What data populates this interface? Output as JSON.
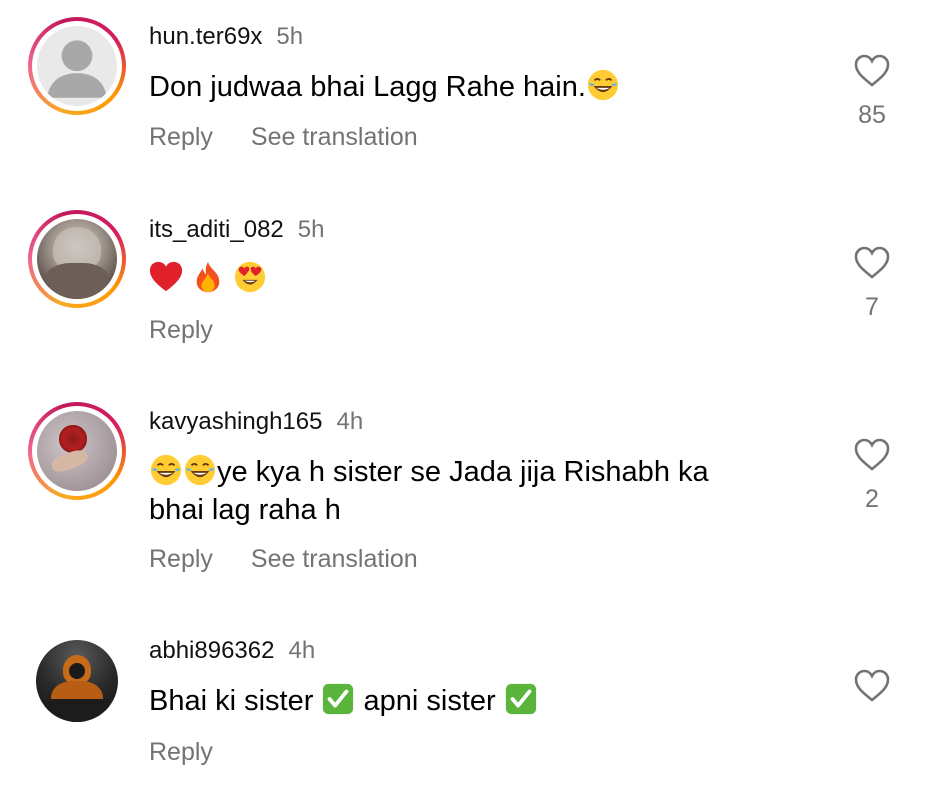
{
  "comments": [
    {
      "username": "hun.ter69x",
      "time": "5h",
      "text": "Don judwaa bhai Lagg Rahe hain.",
      "text_emoji_after": [
        "face-with-tears-of-joy"
      ],
      "reply_label": "Reply",
      "translation_label": "See translation",
      "like_count": "85",
      "avatar": "default-person-icon"
    },
    {
      "username": "its_aditi_082",
      "time": "5h",
      "text": "",
      "text_emoji": [
        "red-heart",
        "fire",
        "heart-eyes-face"
      ],
      "reply_label": "Reply",
      "like_count": "7",
      "avatar": "profile-photo"
    },
    {
      "username": "kavyashingh165",
      "time": "4h",
      "text_line1": "ye kya h sister se Jada jija Rishabh ka",
      "text_line2": "bhai lag raha h",
      "text_emoji_before": [
        "face-with-tears-of-joy",
        "face-with-tears-of-joy"
      ],
      "reply_label": "Reply",
      "translation_label": "See translation",
      "like_count": "2",
      "avatar": "rose-photo"
    },
    {
      "username": "abhi896362",
      "time": "4h",
      "text_part1": "Bhai ki sister",
      "text_part2": "apni sister",
      "text_emoji": [
        "check-mark-button",
        "check-mark-button"
      ],
      "reply_label": "Reply",
      "like_count": "",
      "avatar": "hooded-figure-photo"
    }
  ],
  "colors": {
    "text": "#000000",
    "muted": "#737373",
    "ring_start": "#f9a825",
    "ring_end": "#d81b60"
  }
}
